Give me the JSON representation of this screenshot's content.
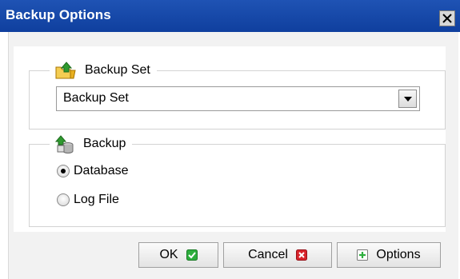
{
  "window": {
    "title": "Backup Options"
  },
  "backup_set_group": {
    "legend": "Backup Set",
    "selected_value": "Backup Set",
    "legend_icon": "folder-up-icon"
  },
  "backup_group": {
    "legend": "Backup",
    "legend_icon": "database-backup-icon",
    "options": [
      {
        "label": "Database",
        "checked": true
      },
      {
        "label": "Log File",
        "checked": false
      }
    ]
  },
  "buttons": {
    "ok": "OK",
    "cancel": "Cancel",
    "options": "Options"
  },
  "colors": {
    "title_bar": "#1f53b4",
    "ok_icon": "#2eae3e",
    "cancel_icon": "#d8232a",
    "options_icon": "#2eae3e"
  }
}
